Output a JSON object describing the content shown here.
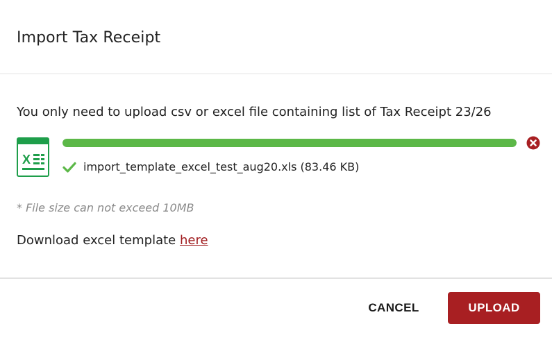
{
  "dialog": {
    "title": "Import Tax Receipt"
  },
  "body": {
    "instructions": "You only need to upload csv or excel file containing list of Tax Receipt 23/26",
    "file": {
      "icon": "excel-file-icon",
      "name": "import_template_excel_test_aug20.xls (83.46 KB)",
      "progress": 1.0,
      "status_icon": "check-icon",
      "remove_icon": "remove-circle-icon"
    },
    "size_note": "* File size can not exceed 10MB",
    "download_prefix": "Download excel template ",
    "download_link": "here"
  },
  "footer": {
    "cancel_label": "CANCEL",
    "upload_label": "UPLOAD"
  },
  "colors": {
    "accent": "#a81f22",
    "progress": "#5cb848",
    "excel_green": "#1e9e4a",
    "note_gray": "#8a8a8a"
  }
}
